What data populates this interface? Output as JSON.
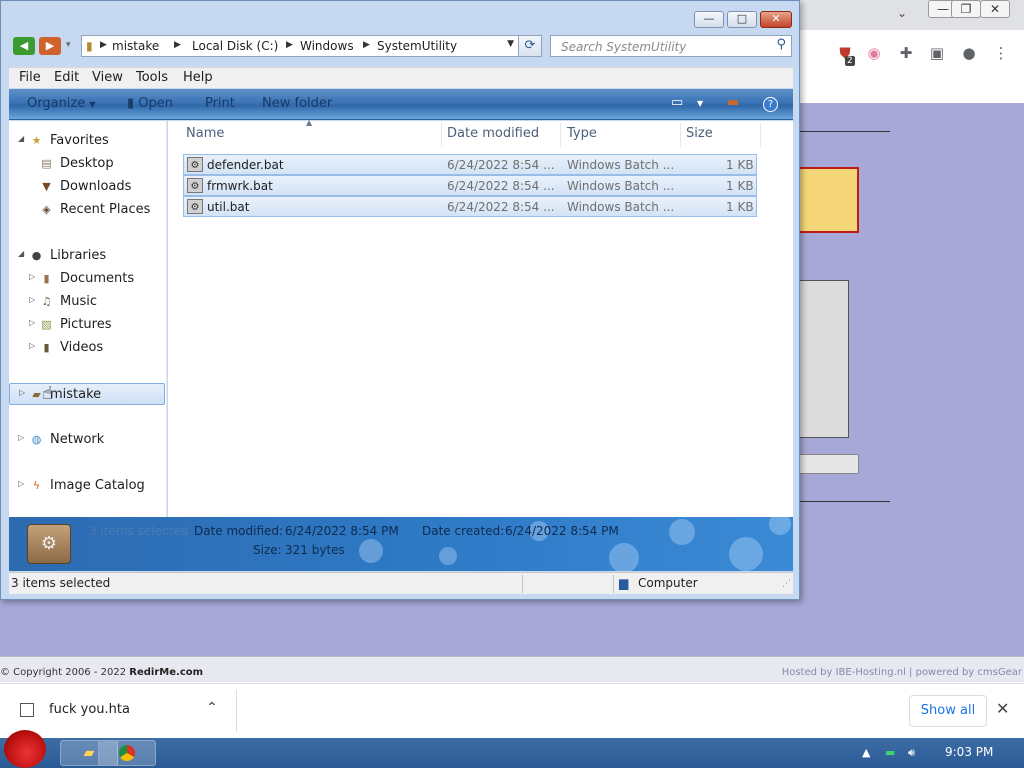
{
  "explorer": {
    "nav": {
      "back_label": "◀",
      "forward_label": "▶"
    },
    "address": {
      "crumbs": [
        "mistake",
        "Local Disk (C:)",
        "Windows",
        "SystemUtility"
      ]
    },
    "search": {
      "placeholder": "Search SystemUtility"
    },
    "menu": [
      "File",
      "Edit",
      "View",
      "Tools",
      "Help"
    ],
    "commands": {
      "organize": "Organize",
      "open": "Open",
      "print": "Print",
      "new_folder": "New folder"
    },
    "navpane": {
      "favorites": {
        "label": "Favorites",
        "items": [
          "Desktop",
          "Downloads",
          "Recent Places"
        ]
      },
      "libraries": {
        "label": "Libraries",
        "items": [
          "Documents",
          "Music",
          "Pictures",
          "Videos"
        ]
      },
      "user": "mistake",
      "network": "Network",
      "image_catalog": "Image Catalog"
    },
    "columns": [
      "Name",
      "Date modified",
      "Type",
      "Size"
    ],
    "files": [
      {
        "name": "defender.bat",
        "modified": "6/24/2022 8:54 ...",
        "type": "Windows Batch ...",
        "size": "1 KB"
      },
      {
        "name": "frmwrk.bat",
        "modified": "6/24/2022 8:54 ...",
        "type": "Windows Batch ...",
        "size": "1 KB"
      },
      {
        "name": "util.bat",
        "modified": "6/24/2022 8:54 ...",
        "type": "Windows Batch ...",
        "size": "1 KB"
      }
    ],
    "details": {
      "count": "3 items selected",
      "modified_label": "Date modified:",
      "modified_value": "6/24/2022 8:54 PM",
      "created_label": "Date created:",
      "created_value": "6/24/2022 8:54 PM",
      "size_label": "Size:",
      "size_value": "321 bytes"
    },
    "status": {
      "left": "3 items selected",
      "right": "Computer"
    }
  },
  "browser": {
    "footer_copyright": "© Copyright 2006 - 2022",
    "footer_brand": "RedirMe.com",
    "footer_hosted": "Hosted by IBE-Hosting.nl",
    "footer_powered": "powered by cmsGear",
    "extension_badge": "2",
    "download_file": "fuck you.hta",
    "show_all": "Show all"
  },
  "taskbar": {
    "clock": "9:03 PM"
  },
  "colors": {
    "accent": "#2e78c4",
    "site_bg": "#a8a8d8",
    "warning_fill": "#f5d679",
    "warning_border": "#c01a1a"
  }
}
